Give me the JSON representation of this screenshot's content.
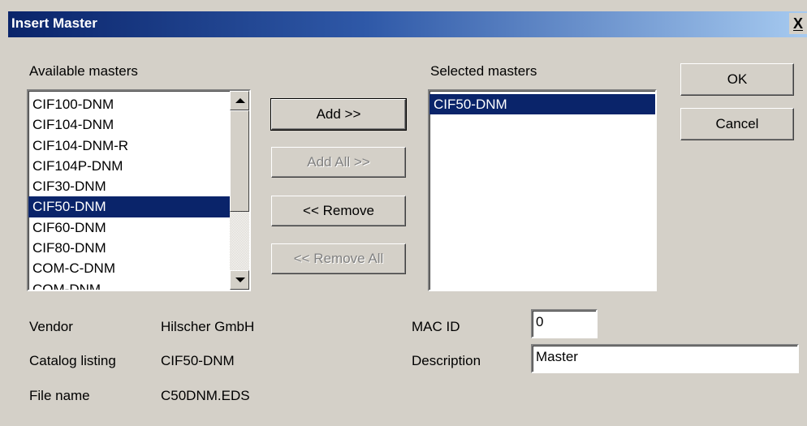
{
  "window": {
    "title": "Insert Master",
    "close_glyph": "X"
  },
  "available": {
    "label": "Available masters",
    "items": [
      "CIF100-DNM",
      "CIF104-DNM",
      "CIF104-DNM-R",
      "CIF104P-DNM",
      "CIF30-DNM",
      "CIF50-DNM",
      "CIF60-DNM",
      "CIF80-DNM",
      "COM-C-DNM",
      "COM-DNM"
    ],
    "selected_index": 5
  },
  "buttons": {
    "add": "Add >>",
    "add_all": "Add All >>",
    "remove": "<< Remove",
    "remove_all": "<< Remove All",
    "ok": "OK",
    "cancel": "Cancel"
  },
  "selected": {
    "label": "Selected masters",
    "items": [
      "CIF50-DNM"
    ]
  },
  "info": {
    "vendor_label": "Vendor",
    "vendor_value": "Hilscher GmbH",
    "catalog_label": "Catalog listing",
    "catalog_value": "CIF50-DNM",
    "file_label": "File name",
    "file_value": "C50DNM.EDS",
    "mac_label": "MAC ID",
    "mac_value": "0",
    "description_label": "Description",
    "description_value": "Master"
  },
  "colors": {
    "selection": "#0a246a",
    "face": "#d4d0c8",
    "title_start": "#0a246a",
    "title_end": "#a6caf0"
  },
  "icons": {
    "close": "close-icon",
    "scroll_up": "arrow-up-icon",
    "scroll_down": "arrow-down-icon"
  }
}
